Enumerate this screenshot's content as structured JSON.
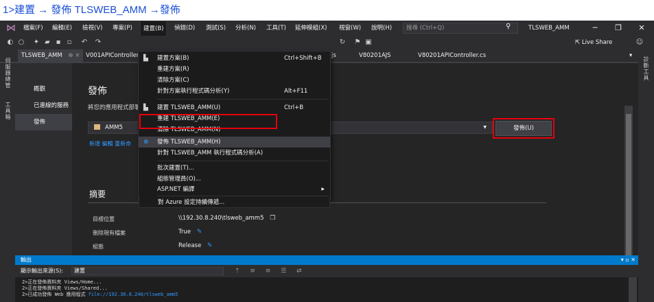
{
  "caption": {
    "text": "1>建置 → 發佈 TLSWEB_AMM →發佈"
  },
  "menubar": {
    "items": [
      "檔案(F)",
      "編輯(E)",
      "檢視(V)",
      "專案(P)",
      "建置(B)",
      "偵錯(D)",
      "測試(S)",
      "分析(N)",
      "工具(T)",
      "延伸模組(X)",
      "視窗(W)",
      "說明(H)"
    ],
    "search_placeholder": "搜尋 (Ctrl+Q)",
    "solution_name": "TLSWEB_AMM"
  },
  "toolbar": {
    "live_share": "Live Share"
  },
  "tabs": [
    {
      "label": "TLSWEB_AMM",
      "pin": "⊕ ×"
    },
    {
      "label": "V001APIController"
    },
    {
      "label": "js"
    },
    {
      "label": "V80201AJS"
    },
    {
      "label": "V80201APIController.cs"
    }
  ],
  "side_tools": {
    "left": "伺服器總管",
    "left2": "工具箱",
    "right": "診斷工具"
  },
  "publish": {
    "nav": [
      "概觀",
      "已連線的服務",
      "發佈"
    ],
    "title": "發佈",
    "description": "將您的應用程式部署...",
    "profile": "AMM5",
    "links": "新增  編輯  重新命",
    "publish_button": "發佈(U)",
    "summary_title": "摘要",
    "summary_rows": [
      {
        "label": "目標位置",
        "value": "\\\\192.30.8.240\\tlsweb_amm5",
        "icon": "copy"
      },
      {
        "label": "刪除現有檔案",
        "value": "True",
        "icon": "pen"
      },
      {
        "label": "組態",
        "value": "Release",
        "icon": "pen"
      }
    ]
  },
  "build_menu": {
    "items": [
      {
        "label": "建置方案(B)",
        "shortcut": "Ctrl+Shift+B",
        "icon": "build-icon"
      },
      {
        "label": "重建方案(R)",
        "shortcut": ""
      },
      {
        "label": "清除方案(C)",
        "shortcut": ""
      },
      {
        "label": "針對方案執行程式碼分析(Y)",
        "shortcut": "Alt+F11"
      },
      {
        "label": "建置 TLSWEB_AMM(U)",
        "shortcut": "Ctrl+B",
        "icon": "build-icon"
      },
      {
        "label": "重建 TLSWEB_AMM(E)",
        "shortcut": ""
      },
      {
        "label": "清除 TLSWEB_AMM(N)",
        "shortcut": ""
      },
      {
        "label": "發佈 TLSWEB_AMM(H)",
        "shortcut": "",
        "icon": "globe-icon"
      },
      {
        "label": "針對 TLSWEB_AMM 執行程式碼分析(A)",
        "shortcut": ""
      },
      {
        "label": "批次建置(T)...",
        "shortcut": ""
      },
      {
        "label": "組態管理員(O)...",
        "shortcut": ""
      },
      {
        "label": "ASP.NET 編譯",
        "shortcut": ""
      },
      {
        "label": "對 Azure 設定持續傳遞...",
        "shortcut": ""
      }
    ]
  },
  "output": {
    "title": "輸出",
    "source_label": "顯示輸出來源(S):",
    "source_value": "建置",
    "lines": [
      "2>正在發佈資料夾 Views/Home...",
      "2>正在發佈資料夾 Views/Shared...",
      "2>已成功發佈 Web 應用程式 "
    ],
    "link": "file://192.30.8.240/tlsweb_amm5"
  },
  "colors": {
    "accent": "#007acc",
    "highlight_box": "#e8000b",
    "link": "#3399ff"
  }
}
